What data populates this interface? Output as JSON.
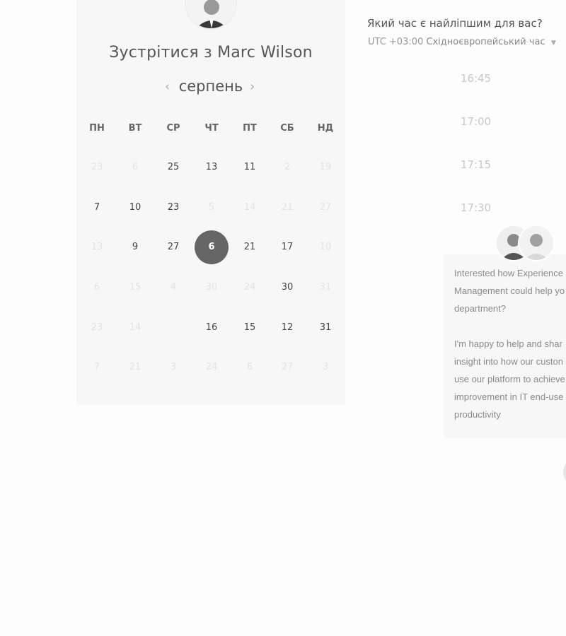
{
  "host": {
    "title": "Зустрітися з Marc Wilson",
    "avatar_icon": "person-avatar-icon"
  },
  "calendar": {
    "month": "серпень",
    "prev_icon": "chevron-left-icon",
    "next_icon": "chevron-right-icon",
    "weekdays": [
      "ПН",
      "ВТ",
      "СР",
      "ЧТ",
      "ПТ",
      "СБ",
      "НД"
    ],
    "weeks": [
      [
        "23",
        "6",
        "25",
        "13",
        "11",
        "2",
        "19"
      ],
      [
        "7",
        "10",
        "23",
        "5",
        "14",
        "21",
        "27"
      ],
      [
        "13",
        "9",
        "27",
        "6",
        "21",
        "17",
        "10"
      ],
      [
        "6",
        "15",
        "4",
        "30",
        "24",
        "30",
        "31"
      ],
      [
        "23",
        "14",
        "",
        "16",
        "15",
        "12",
        "31"
      ],
      [
        "7",
        "21",
        "3",
        "24",
        "6",
        "27",
        "3"
      ]
    ],
    "available": [
      [
        false,
        false,
        true,
        true,
        true,
        false,
        false
      ],
      [
        true,
        true,
        true,
        false,
        false,
        false,
        false
      ],
      [
        false,
        true,
        true,
        true,
        true,
        true,
        false
      ],
      [
        false,
        false,
        false,
        false,
        false,
        true,
        false
      ],
      [
        false,
        false,
        false,
        true,
        true,
        true,
        true
      ],
      [
        false,
        false,
        false,
        false,
        false,
        false,
        false
      ]
    ],
    "selected": "6",
    "selected_color": "#666666"
  },
  "times": {
    "question": "Який час є найліпшим для вас?",
    "tz_offset": "UTC +03:00",
    "tz_name": "Східноєвропейський час",
    "slots": [
      "16:45",
      "17:00",
      "17:15",
      "17:30"
    ]
  },
  "chat": {
    "lines": [
      "Interested how Experience",
      "Management could help yo",
      "department?",
      "",
      "I'm happy to help and shar",
      "insight into how our custon",
      "use our platform to achieve",
      "improvement in IT end-use",
      "productivity"
    ]
  }
}
